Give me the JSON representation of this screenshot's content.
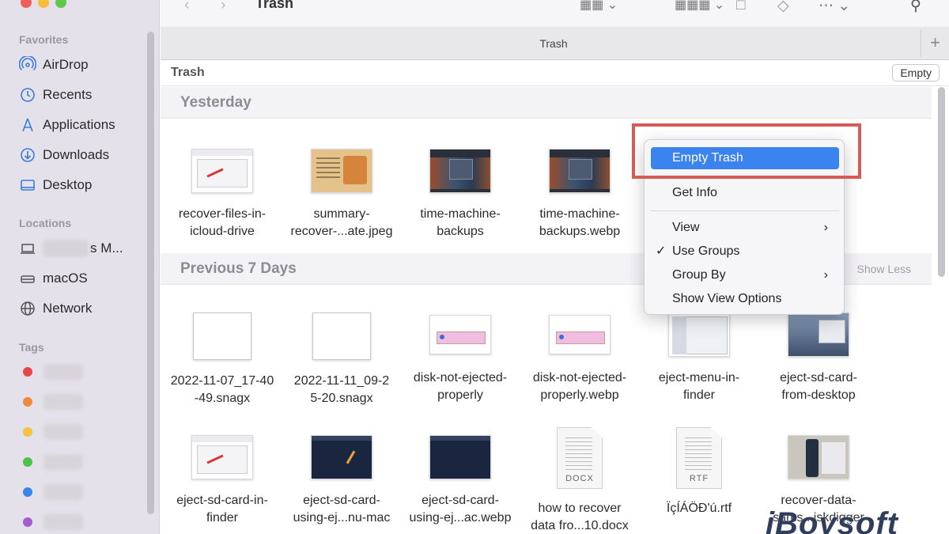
{
  "window": {
    "title": "Trash",
    "tab_label": "Trash",
    "tab_add": "+"
  },
  "sidebar": {
    "favorites_header": "Favorites",
    "favorites": [
      {
        "label": "AirDrop",
        "icon": "airdrop-icon"
      },
      {
        "label": "Recents",
        "icon": "clock-icon"
      },
      {
        "label": "Applications",
        "icon": "applications-icon"
      },
      {
        "label": "Downloads",
        "icon": "downloads-icon"
      },
      {
        "label": "Desktop",
        "icon": "desktop-icon"
      }
    ],
    "locations_header": "Locations",
    "locations": [
      {
        "label": "s M...",
        "icon": "laptop-icon"
      },
      {
        "label": "macOS",
        "icon": "disk-icon"
      },
      {
        "label": "Network",
        "icon": "globe-icon"
      }
    ],
    "tags_header": "Tags",
    "tag_colors": [
      "#e8474a",
      "#ee8b3a",
      "#f3c23e",
      "#4ec248",
      "#3a84f0",
      "#a55bd0"
    ]
  },
  "pathbar": {
    "title": "Trash",
    "empty_button": "Empty"
  },
  "groups": [
    {
      "title": "Yesterday",
      "action": "",
      "files": [
        {
          "name": "recover-files-in-icloud-drive",
          "line1": "recover-files-in-",
          "line2": "icloud-drive"
        },
        {
          "name": "summary-recover-...ate.jpeg",
          "line1": "summary-",
          "line2": "recover-...ate.jpeg"
        },
        {
          "name": "time-machine-backups",
          "line1": "time-machine-",
          "line2": "backups"
        },
        {
          "name": "time-machine-backups.webp",
          "line1": "time-machine-",
          "line2": "backups.webp"
        }
      ]
    },
    {
      "title": "Previous 7 Days",
      "action": "Show Less",
      "files": [
        {
          "name": "2022-11-07_17-40-49.snagx",
          "line1": "2022-11-07_17-40",
          "line2": "-49.snagx"
        },
        {
          "name": "2022-11-11_09-25-20.snagx",
          "line1": "2022-11-11_09-2",
          "line2": "5-20.snagx"
        },
        {
          "name": "disk-not-ejected-properly",
          "line1": "disk-not-ejected-",
          "line2": "properly"
        },
        {
          "name": "disk-not-ejected-properly.webp",
          "line1": "disk-not-ejected-",
          "line2": "properly.webp"
        },
        {
          "name": "eject-menu-in-finder",
          "line1": "eject-menu-in-",
          "line2": "finder"
        },
        {
          "name": "eject-sd-card-from-desktop",
          "line1": "eject-sd-card-",
          "line2": "from-desktop"
        },
        {
          "name": "eject-sd-card-in-finder",
          "line1": "eject-sd-card-in-",
          "line2": "finder"
        },
        {
          "name": "eject-sd-card-using-ej...nu-mac",
          "line1": "eject-sd-card-",
          "line2": "using-ej...nu-mac"
        },
        {
          "name": "eject-sd-card-using-ej...ac.webp",
          "line1": "eject-sd-card-",
          "line2": "using-ej...ac.webp"
        },
        {
          "name": "how to recover data fro...10.docx",
          "line1": "how to recover",
          "line2": "data fro...10.docx",
          "ext": "DOCX"
        },
        {
          "name": "ÏçÍÁÖÐ'ú.rtf",
          "line1": "ÏçÍÁÖÐ'ú.rtf",
          "line2": "",
          "ext": "RTF"
        },
        {
          "name": "recover-data-sams...iskdigger",
          "line1": "recover-data-",
          "line2": "sams...iskdigger"
        }
      ]
    }
  ],
  "context_menu": {
    "items": [
      {
        "label": "Empty Trash",
        "highlighted": true
      },
      {
        "label": "Get Info"
      },
      {
        "label": "View",
        "submenu": true
      },
      {
        "label": "Use Groups",
        "checked": true
      },
      {
        "label": "Group By",
        "submenu": true
      },
      {
        "label": "Show View Options"
      }
    ],
    "callout_color": "#d75a55",
    "highlight_color": "#3b84f0"
  },
  "watermark": "iBoysoft"
}
